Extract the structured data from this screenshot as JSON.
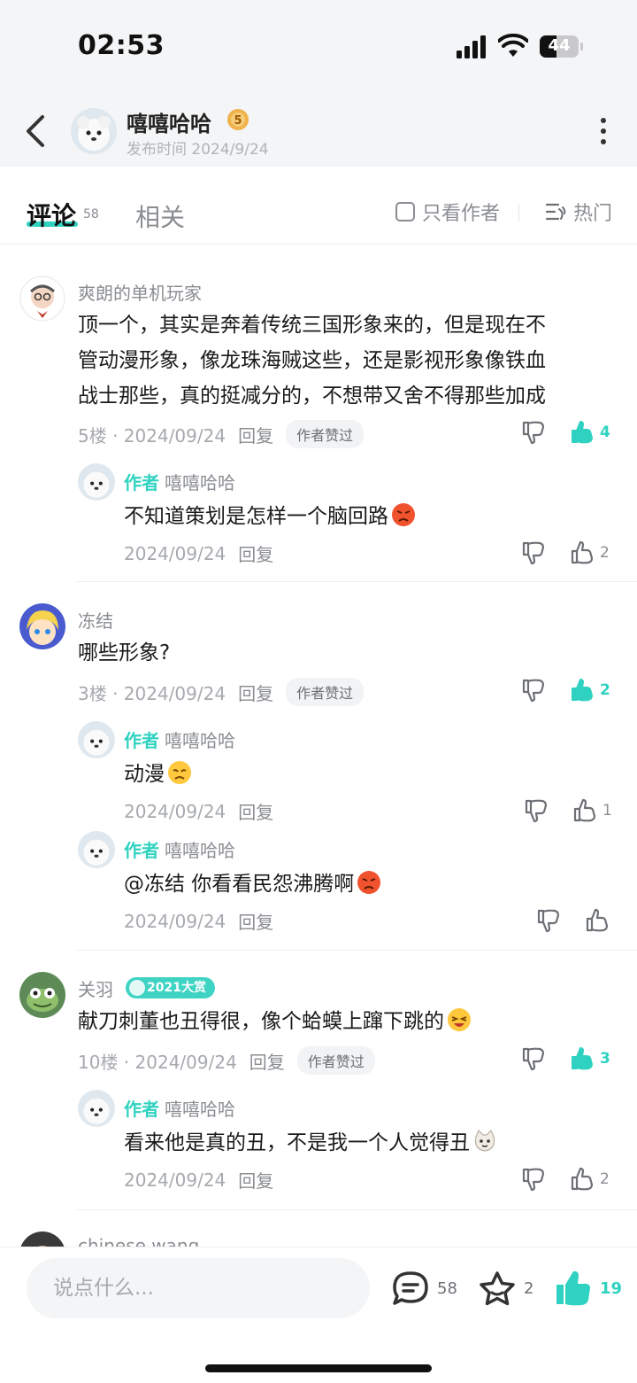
{
  "status": {
    "time": "02:53",
    "battery": "44",
    "battery_level": 0.44
  },
  "post": {
    "author": "嘻嘻哈哈",
    "level": "5",
    "published": "发布时间 2024/9/24"
  },
  "tabs": {
    "comments_label": "评论",
    "comments_count": "58",
    "related_label": "相关",
    "only_author_label": "只看作者",
    "sort_label": "热门"
  },
  "comments": [
    {
      "user": "爽朗的单机玩家",
      "lines": [
        "顶一个，其实是奔着传统三国形象来的，但是现在不",
        "管动漫形象，像龙珠海贼这些，还是影视形象像铁血",
        "战士那些，真的挺减分的，不想带又舍不得那些加成"
      ],
      "floor_date": "5楼 · 2024/09/24",
      "reply_label": "回复",
      "badge": "作者赞过",
      "likes": "4",
      "replies": [
        {
          "tag": "作者",
          "user": "嘻嘻哈哈",
          "text": "不知道策划是怎样一个脑回路",
          "date": "2024/09/24",
          "reply_label": "回复",
          "likes": "2"
        }
      ]
    },
    {
      "user": "冻结",
      "lines": [
        "哪些形象?"
      ],
      "floor_date": "3楼 · 2024/09/24",
      "reply_label": "回复",
      "badge": "作者赞过",
      "likes": "2",
      "replies": [
        {
          "tag": "作者",
          "user": "嘻嘻哈哈",
          "text": "动漫",
          "date": "2024/09/24",
          "reply_label": "回复",
          "likes": "1"
        },
        {
          "tag": "作者",
          "user": "嘻嘻哈哈",
          "text": "@冻结 你看看民怨沸腾啊",
          "date": "2024/09/24",
          "reply_label": "回复",
          "likes": ""
        }
      ]
    },
    {
      "user": "关羽",
      "user_badge": "2021大赏",
      "lines": [
        "献刀刺董也丑得很，像个蛤蟆上蹿下跳的"
      ],
      "floor_date": "10楼 · 2024/09/24",
      "reply_label": "回复",
      "badge": "作者赞过",
      "likes": "3",
      "replies": [
        {
          "tag": "作者",
          "user": "嘻嘻哈哈",
          "text": "看来他是真的丑，不是我一个人觉得丑",
          "date": "2024/09/24",
          "reply_label": "回复",
          "likes": "2"
        }
      ]
    },
    {
      "user": "chinese wang"
    }
  ],
  "bottom": {
    "input_placeholder": "说点什么...",
    "comments": "58",
    "favorites": "2",
    "likes": "19"
  },
  "colors": {
    "accent": "#2fd2c0",
    "muted": "#8a8d92",
    "header_bg": "#f4f5f6"
  },
  "icons": [
    "back-chevron-icon",
    "more-icon",
    "level-badge-icon",
    "checkbox-icon",
    "sort-icon",
    "thumb-down-icon",
    "thumb-up-icon",
    "angry-emoji-icon",
    "sad-emoji-icon",
    "laugh-emoji-icon",
    "cat-emoji-icon",
    "comment-icon",
    "star-icon",
    "signal-icon",
    "wifi-icon",
    "battery-icon"
  ]
}
